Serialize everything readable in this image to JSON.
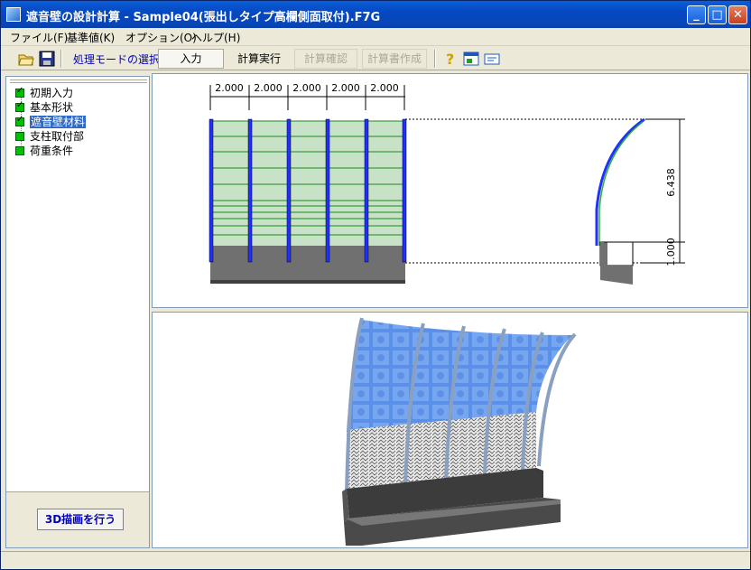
{
  "window": {
    "title": "遮音壁の設計計算 - Sample04(張出しタイプ高欄側面取付).F7G",
    "min": "_",
    "max": "□",
    "close": "✕"
  },
  "menu": [
    "ファイル(F)",
    "基準値(K)",
    "オプション(O)",
    "ヘルプ(H)"
  ],
  "toolbar": {
    "mode_label": "処理モードの選択",
    "modes": [
      "入力",
      "計算実行",
      "計算確認",
      "計算書作成"
    ],
    "active_mode": "入力"
  },
  "tree": {
    "items": [
      {
        "label": "初期入力",
        "checked": true,
        "selected": false
      },
      {
        "label": "基本形状",
        "checked": true,
        "selected": false
      },
      {
        "label": "遮音壁材料",
        "checked": true,
        "selected": true
      },
      {
        "label": "支柱取付部",
        "checked": false,
        "selected": false
      },
      {
        "label": "荷重条件",
        "checked": false,
        "selected": false
      }
    ]
  },
  "draw3d_button": "3D描画を行う",
  "drawing": {
    "spans": [
      "2.000",
      "2.000",
      "2.000",
      "2.000",
      "2.000"
    ],
    "height_upper": "6.438",
    "height_lower": "1.000"
  },
  "colors": {
    "panel": "#c8e2c8",
    "post": "#2030ff",
    "base": "#707070",
    "accent": "#316ac5"
  }
}
